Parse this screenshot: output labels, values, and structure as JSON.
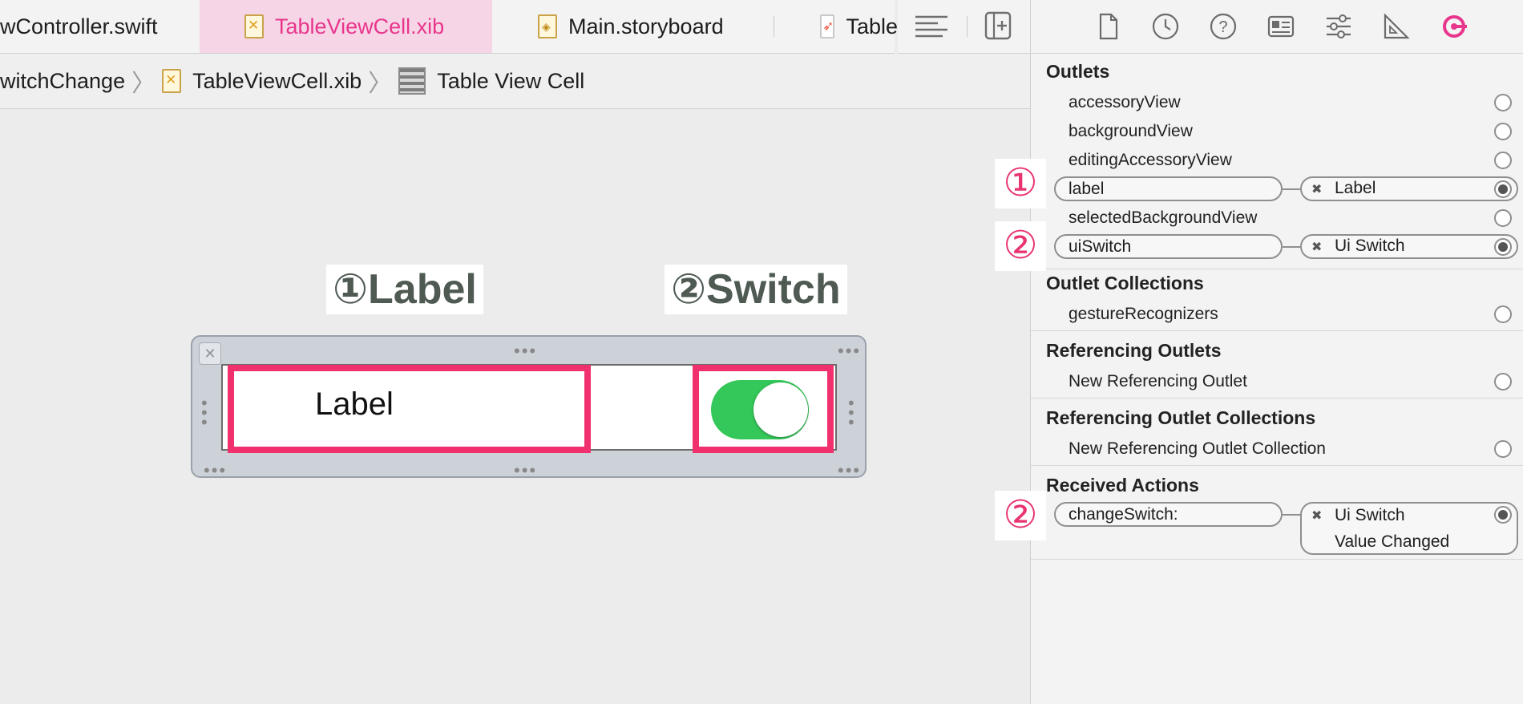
{
  "tabs": [
    {
      "label": "wController.swift",
      "icon": "swift-file-icon"
    },
    {
      "label": "TableViewCell.xib",
      "icon": "xib-file-icon",
      "active": true
    },
    {
      "label": "Main.storyboard",
      "icon": "storyboard-file-icon"
    },
    {
      "label": "Table",
      "icon": "swift-file-icon"
    }
  ],
  "breadcrumb": {
    "items": [
      "witchChange",
      "TableViewCell.xib",
      "Table View Cell"
    ]
  },
  "canvas": {
    "annotation_label": "①Label",
    "annotation_switch": "②Switch",
    "cell_label": "Label",
    "switch_state": "on"
  },
  "inspector": {
    "sections": {
      "outlets": "Outlets",
      "outlet_collections": "Outlet Collections",
      "referencing_outlets": "Referencing Outlets",
      "referencing_outlet_collections": "Referencing Outlet Collections",
      "received_actions": "Received Actions"
    },
    "outlets": {
      "accessory_view": "accessoryView",
      "background_view": "backgroundView",
      "editing_accessory_view": "editingAccessoryView",
      "label": "label",
      "label_target": "Label",
      "selected_background_view": "selectedBackgroundView",
      "ui_switch": "uiSwitch",
      "ui_switch_target": "Ui Switch"
    },
    "outlet_collections": {
      "gesture_recognizers": "gestureRecognizers"
    },
    "referencing_outlets": {
      "new": "New Referencing Outlet"
    },
    "referencing_outlet_collections": {
      "new": "New Referencing Outlet Collection"
    },
    "received_actions": {
      "change_switch": "changeSwitch:",
      "target_object": "Ui Switch",
      "target_event": "Value Changed"
    },
    "badges": {
      "one": "①",
      "two": "②"
    }
  },
  "colors": {
    "accent": "#e8368c",
    "highlight": "#f0316e",
    "switch_on": "#34c759"
  }
}
